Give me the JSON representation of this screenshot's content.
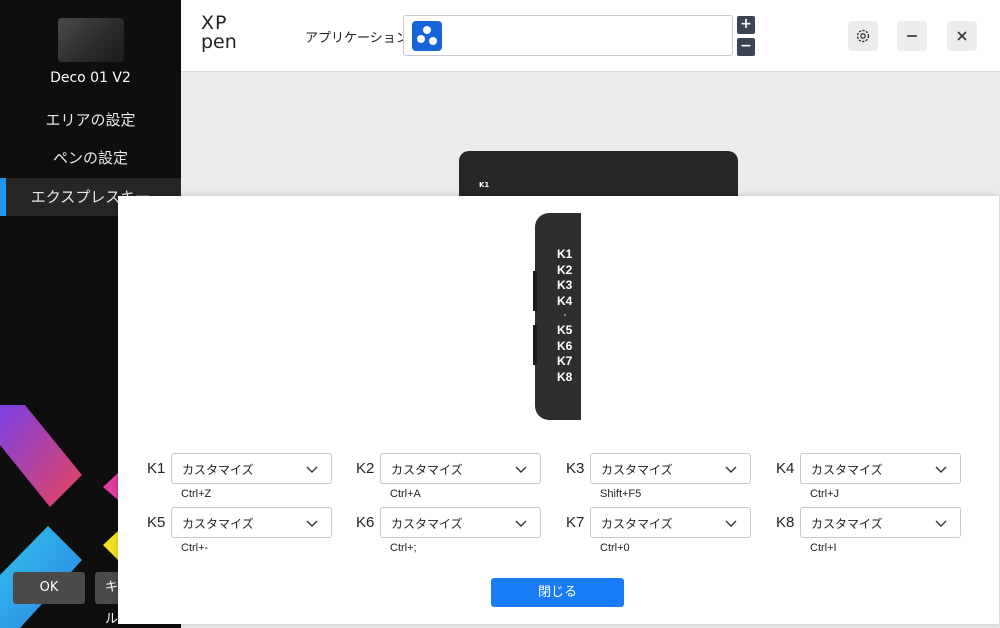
{
  "sidebar": {
    "device_name": "Deco 01 V2",
    "items": [
      {
        "label": "エリアの設定"
      },
      {
        "label": "ペンの設定"
      },
      {
        "label": "エクスプレスキー"
      }
    ],
    "ok_label": "OK",
    "cancel_label": "キャンセル"
  },
  "header": {
    "logo_line1": "XP",
    "logo_line2": "pen",
    "app_label": "アプリケーション:",
    "add_label": "+",
    "remove_label": "−"
  },
  "preview": {
    "k1_label": "K1"
  },
  "dialog": {
    "tablet_keys": [
      "K1",
      "K2",
      "K3",
      "K4",
      "K5",
      "K6",
      "K7",
      "K8"
    ],
    "keys": [
      {
        "name": "K1",
        "value": "カスタマイズ",
        "shortcut": "Ctrl+Z"
      },
      {
        "name": "K2",
        "value": "カスタマイズ",
        "shortcut": "Ctrl+A"
      },
      {
        "name": "K3",
        "value": "カスタマイズ",
        "shortcut": "Shift+F5"
      },
      {
        "name": "K4",
        "value": "カスタマイズ",
        "shortcut": "Ctrl+J"
      },
      {
        "name": "K5",
        "value": "カスタマイズ",
        "shortcut": "Ctrl+-"
      },
      {
        "name": "K6",
        "value": "カスタマイズ",
        "shortcut": "Ctrl+;"
      },
      {
        "name": "K7",
        "value": "カスタマイズ",
        "shortcut": "Ctrl+0"
      },
      {
        "name": "K8",
        "value": "カスタマイズ",
        "shortcut": "Ctrl+I"
      }
    ],
    "close_label": "閉じる"
  },
  "colors": {
    "accent": "#1a7cf5",
    "sidebar_bg": "#0e0e0e",
    "active_indicator": "#2196f3"
  }
}
